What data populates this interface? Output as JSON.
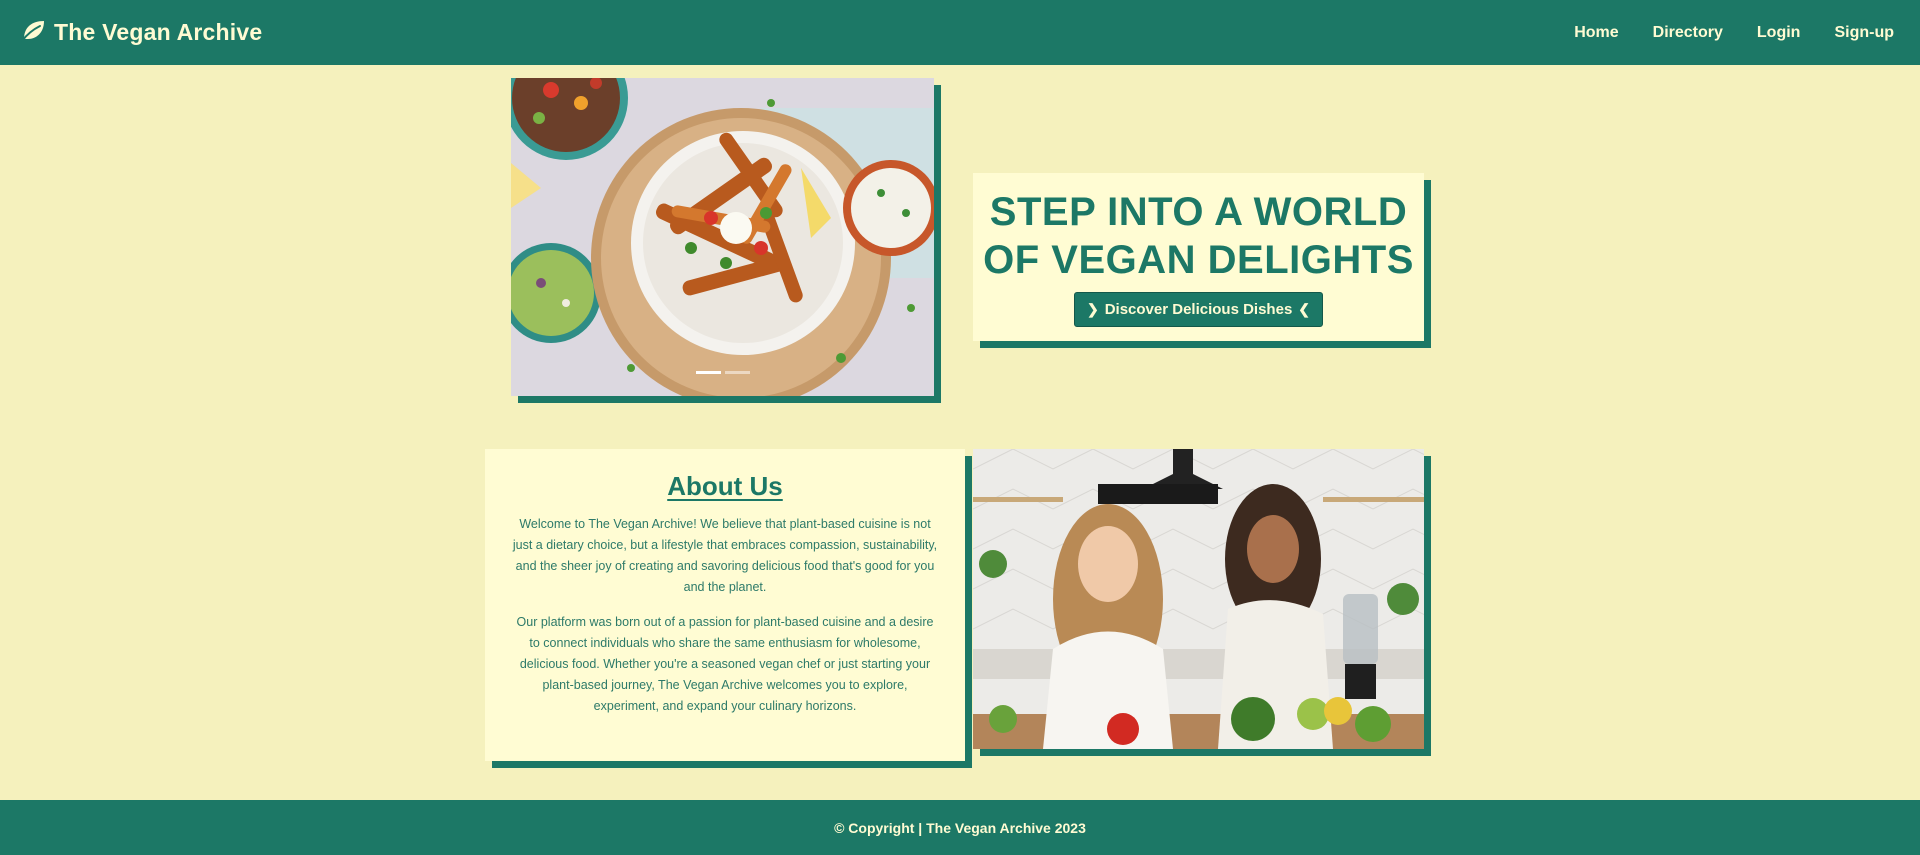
{
  "navbar": {
    "brand_icon": "leaf-icon",
    "brand_name": "The Vegan Archive",
    "links": [
      "Home",
      "Directory",
      "Login",
      "Sign-up"
    ]
  },
  "carousel": {
    "image": "vegan-dish-photo",
    "indicator_count": 2,
    "active_index": 0
  },
  "hero": {
    "title_line1": "STEP INTO A WORLD",
    "title_line2": "OF VEGAN DELIGHTS",
    "button_label": "Discover Delicious Dishes",
    "button_icon_left": "chevron-right-icon",
    "button_icon_right": "chevron-left-icon"
  },
  "about": {
    "title": "About Us",
    "paragraph1": "Welcome to The Vegan Archive! We believe that plant-based cuisine is not just a dietary choice, but a lifestyle that embraces compassion, sustainability, and the sheer joy of creating and savoring delicious food that's good for you and the planet.",
    "paragraph2": "Our platform was born out of a passion for plant-based cuisine and a desire to connect individuals who share the same enthusiasm for wholesome, delicious food. Whether you're a seasoned vegan chef or just starting your plant-based journey, The Vegan Archive welcomes you to explore, experiment, and expand your culinary horizons."
  },
  "kitchen": {
    "image": "two-women-cooking-photo"
  },
  "footer": {
    "text": "© Copyright | The Vegan Archive 2023"
  },
  "colors": {
    "primary": "#1c7866",
    "background": "#f5f1bd",
    "card": "#fffcd3",
    "text_light": "#fffbd3"
  }
}
